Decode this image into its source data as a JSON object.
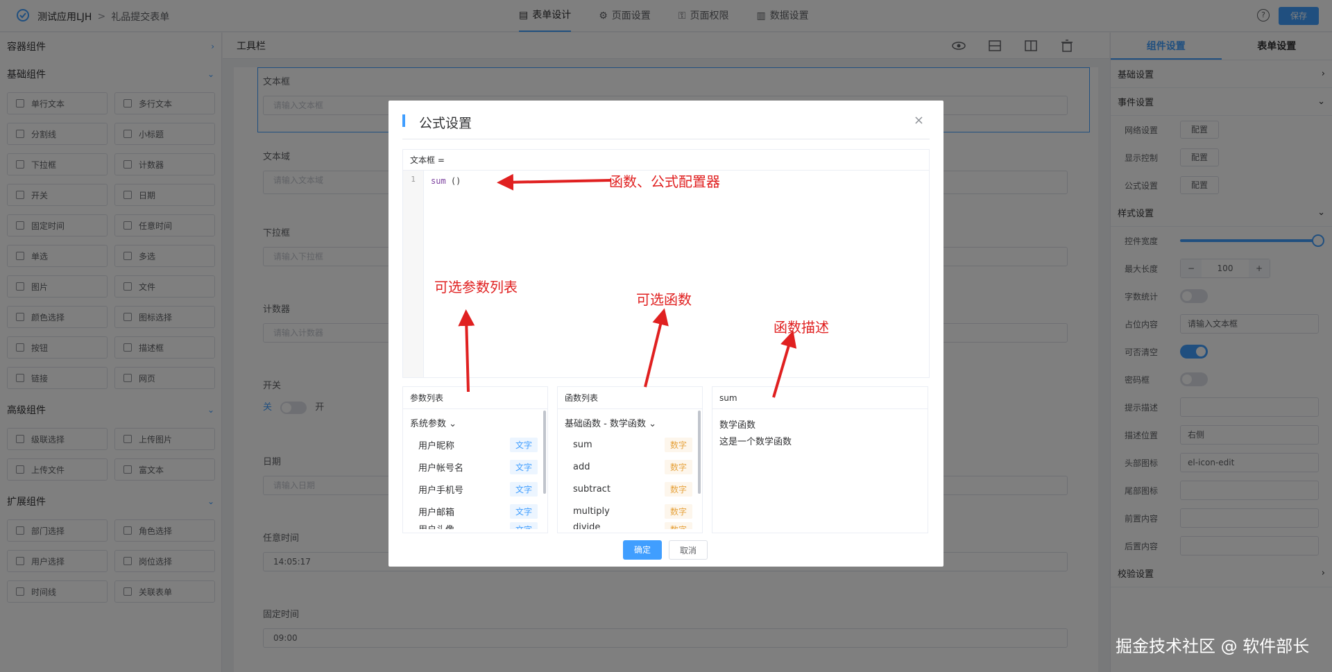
{
  "topbar": {
    "app_name": "测试应用LJH",
    "separator": ">",
    "page_name": "礼品提交表单",
    "tabs": [
      {
        "label": "表单设计",
        "icon": "document-icon"
      },
      {
        "label": "页面设置",
        "icon": "gear-icon"
      },
      {
        "label": "页面权限",
        "icon": "lock-icon"
      },
      {
        "label": "数据设置",
        "icon": "bar-chart-icon"
      }
    ],
    "help_icon": "?",
    "save_label": "保存"
  },
  "left": {
    "container_title": "容器组件",
    "basic_title": "基础组件",
    "basic_items": [
      "单行文本",
      "多行文本",
      "分割线",
      "小标题",
      "下拉框",
      "计数器",
      "开关",
      "日期",
      "固定时间",
      "任意时间",
      "单选",
      "多选",
      "图片",
      "文件",
      "颜色选择",
      "图标选择",
      "按钮",
      "描述框",
      "链接",
      "网页"
    ],
    "advanced_title": "高级组件",
    "advanced_items": [
      "级联选择",
      "上传图片",
      "上传文件",
      "富文本"
    ],
    "extended_title": "扩展组件",
    "extended_items": [
      "部门选择",
      "角色选择",
      "用户选择",
      "岗位选择",
      "时间线",
      "关联表单"
    ]
  },
  "canvas": {
    "toolbar_title": "工具栏",
    "fields": [
      {
        "label": "文本框",
        "placeholder": "请输入文本框"
      },
      {
        "label": "文本域",
        "placeholder": "请输入文本域"
      },
      {
        "label": "下拉框",
        "placeholder": "请输入下拉框"
      },
      {
        "label": "计数器",
        "placeholder": "请输入计数器"
      },
      {
        "label": "开关",
        "off": "关",
        "on": "开"
      },
      {
        "label": "日期",
        "placeholder": "请输入日期"
      },
      {
        "label": "任意时间",
        "value": "14:05:17"
      },
      {
        "label": "固定时间",
        "value": "09:00"
      }
    ]
  },
  "right": {
    "tab_component": "组件设置",
    "tab_form": "表单设置",
    "basic": "基础设置",
    "event": "事件设置",
    "event_rows": [
      {
        "label": "网络设置",
        "btn": "配置"
      },
      {
        "label": "显示控制",
        "btn": "配置"
      },
      {
        "label": "公式设置",
        "btn": "配置"
      }
    ],
    "style": "样式设置",
    "style_rows": {
      "width": "控件宽度",
      "maxlen": "最大长度",
      "maxlen_minus": "−",
      "maxlen_value": "100",
      "maxlen_plus": "+",
      "count": "字数统计",
      "placeholder": "占位内容",
      "placeholder_value": "请输入文本框",
      "clearable": "可否清空",
      "password": "密码框",
      "tip": "提示描述",
      "desc_pos": "描述位置",
      "desc_pos_value": "右侧",
      "head_icon": "头部图标",
      "head_icon_value": "el-icon-edit",
      "tail_icon": "尾部图标",
      "prefix": "前置内容",
      "suffix": "后置内容"
    },
    "validate": "校验设置"
  },
  "modal": {
    "title": "公式设置",
    "close": "×",
    "expr_label": "文本框 =",
    "line_no": "1",
    "code_fn": "sum",
    "code_rest": " ()",
    "params_title": "参数列表",
    "params_group": "系统参数",
    "params": [
      {
        "name": "用户昵称",
        "type": "文字"
      },
      {
        "name": "用户帐号名",
        "type": "文字"
      },
      {
        "name": "用户手机号",
        "type": "文字"
      },
      {
        "name": "用户邮箱",
        "type": "文字"
      },
      {
        "name": "用户头像",
        "type": "文字"
      }
    ],
    "funcs_title": "函数列表",
    "funcs_group": "基础函数 - 数学函数",
    "funcs": [
      {
        "name": "sum",
        "type": "数字"
      },
      {
        "name": "add",
        "type": "数字"
      },
      {
        "name": "subtract",
        "type": "数字"
      },
      {
        "name": "multiply",
        "type": "数字"
      },
      {
        "name": "divide",
        "type": "数字"
      }
    ],
    "desc_title": "sum",
    "desc_line1": "数学函数",
    "desc_line2": "这是一个数学函数",
    "ok": "确定",
    "cancel": "取消"
  },
  "annotations": {
    "editor": "函数、公式配置器",
    "params": "可选参数列表",
    "funcs": "可选函数",
    "desc": "函数描述"
  },
  "watermark": "掘金技术社区 @ 软件部长"
}
